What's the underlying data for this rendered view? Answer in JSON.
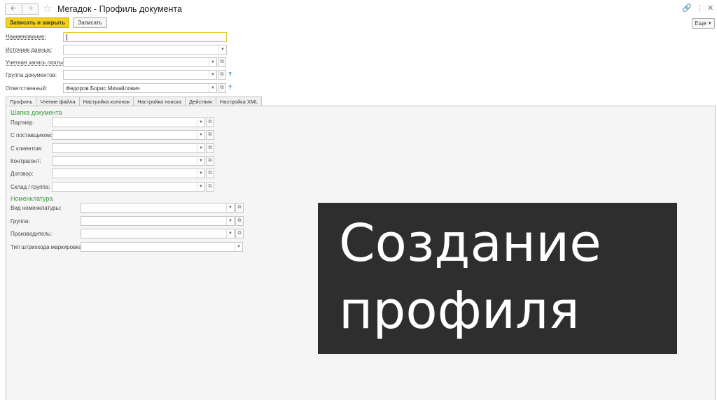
{
  "window": {
    "title": "Мегадок - Профиль документа",
    "back_icon": "arrow-left-icon",
    "forward_icon": "arrow-right-icon"
  },
  "toolbar": {
    "save_close_label": "Записать и закрыть",
    "save_label": "Записать",
    "more_label": "Еще"
  },
  "header_fields": {
    "name_label": "Наименование:",
    "name_value": "",
    "source_label": "Источник данных:",
    "source_value": "",
    "mail_label": "Учетная запись почты:",
    "mail_value": "",
    "group_label": "Группа документов:",
    "group_value": "",
    "responsible_label": "Ответственный:",
    "responsible_value": "Федоров Борис Михайлович"
  },
  "tabs": [
    "Профиль",
    "Чтение файла",
    "Настройка колонок",
    "Настройка поиска",
    "Действия",
    "Настройка XML"
  ],
  "profile": {
    "header_section": "Шапка документа",
    "partner_label": "Партнер:",
    "supplier_label": "С поставщиком:",
    "client_label": "С клиентом:",
    "counterparty_label": "Контрагент:",
    "contract_label": "Договор:",
    "warehouse_label": "Склад / группа:",
    "nomenclature_section": "Номенклатура",
    "nom_type_label": "Вид номенклатуры:",
    "nom_group_label": "Группа:",
    "manufacturer_label": "Производитель:",
    "barcode_type_label": "Тип штрихкода маркировка:"
  },
  "overlay": {
    "line1": "Создание",
    "line2": "профиля"
  },
  "colors": {
    "accent_button": "#f5d218",
    "section_heading": "#3a9a3a",
    "overlay_bg": "#2e2e2e"
  }
}
